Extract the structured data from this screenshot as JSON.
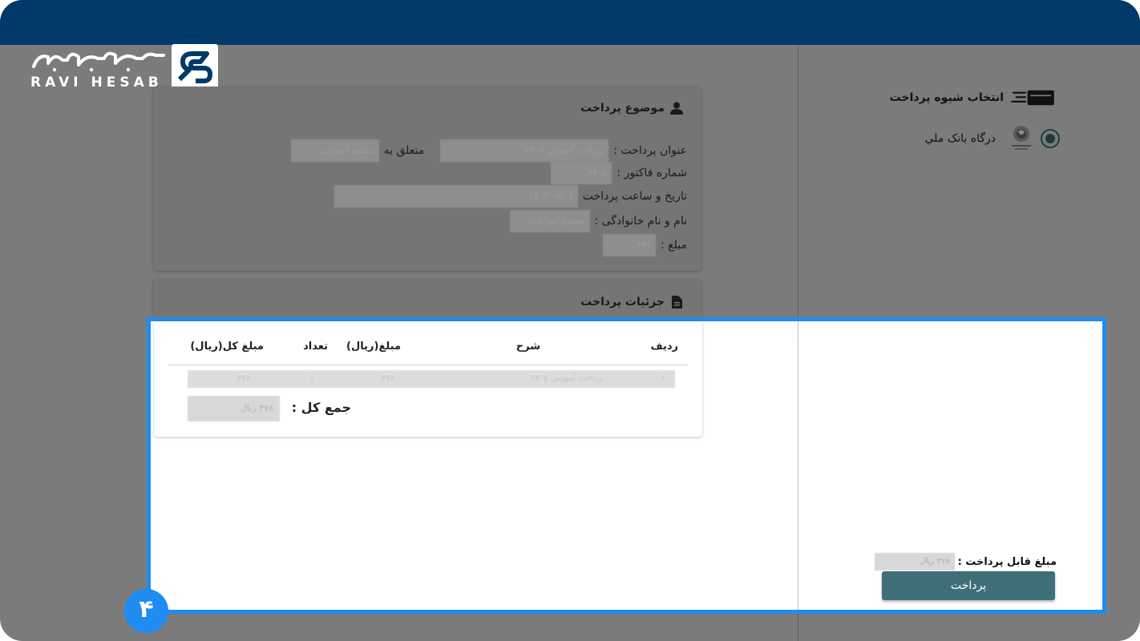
{
  "brand": {
    "name_fa": "راوی حساب",
    "name_en": "RAVI HESAB"
  },
  "subject_card": {
    "title": "موضوع پرداخت",
    "rows": [
      {
        "label": "عنوان پرداخت :",
        "value": "پرداخت آموزش ۲۴۰۵",
        "suffix": "متعلق به",
        "owner": "مجتمع آموزشی"
      },
      {
        "label": "شماره فاکتور :",
        "value": "۲۴۰۵"
      },
      {
        "label": "تاریخ و ساعت پرداخت",
        "value": "۱۴۰۳/۰۵/۰۸"
      },
      {
        "label": "نام و نام خانوادگی :",
        "value": "مجتمع آموزشی"
      },
      {
        "label": "مبلغ :",
        "value": "۳۷۸"
      }
    ]
  },
  "details_card": {
    "title": "جزئیات پرداخت",
    "columns": {
      "row": "ردیف",
      "desc": "شرح",
      "amount": "مبلغ(ریال)",
      "qty": "تعداد",
      "total": "مبلغ کل(ریال)"
    },
    "row": {
      "row": "۱",
      "desc": "پرداخت آموزش ۲۴۰۵",
      "amount": "۳۷۸",
      "qty": "۱",
      "total": "۳۷۸"
    },
    "total_label": "جمع کل :",
    "total_value": "۳۷۸ ریال"
  },
  "method": {
    "title": "انتخاب شیوه پرداخت",
    "option_label": "درگاه بانک ملي",
    "selected": true
  },
  "payable": {
    "label": "مبلغ قابل پرداخت :",
    "value": "۳۷۸ ریال"
  },
  "pay_button": "پرداخت",
  "step_badge": "۴",
  "colors": {
    "topbar": "#003a6a",
    "highlight": "#1e8cf0",
    "pay_button": "#3e6f78"
  }
}
